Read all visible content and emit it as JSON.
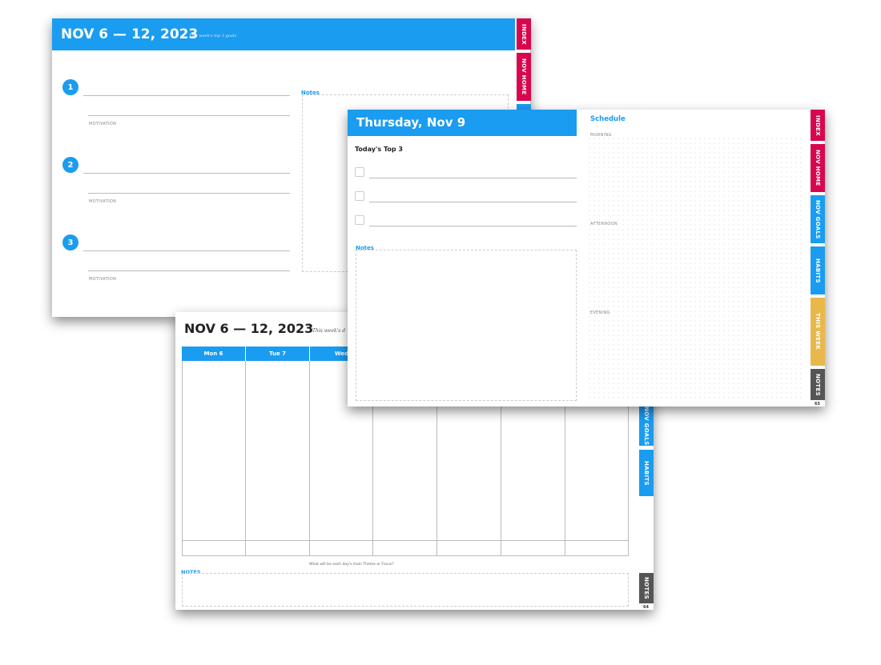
{
  "weekly_goals_page": {
    "title": "NOV 6 — 12, 2023",
    "subtitle": "This week's top 3 goals",
    "goals": [
      {
        "number": "1",
        "label": "MOTIVATION"
      },
      {
        "number": "2",
        "label": "MOTIVATION"
      },
      {
        "number": "3",
        "label": "MOTIVATION"
      }
    ],
    "notes_label": "Notes",
    "tabs": [
      "INDEX",
      "NOV HOME"
    ]
  },
  "weekly_page": {
    "title": "NOV 6 — 12, 2023",
    "subtitle": "This week's d",
    "days": [
      "Mon 6",
      "Tue 7",
      "Wed"
    ],
    "prompt": "What will be each day's main Theme or Focus?",
    "notes_label": "NOTES",
    "tabs": [
      "NOV GOALS",
      "HABITS",
      "NOTES"
    ],
    "page_number": "64"
  },
  "daily_page": {
    "title": "Thursday, Nov 9",
    "top3_label": "Today's Top 3",
    "notes_label": "Notes",
    "schedule_label": "Schedule",
    "morning": "MORNING",
    "afternoon": "AFTERNOON",
    "evening": "EVENING",
    "tabs": [
      "INDEX",
      "NOV HOME",
      "NOV GOALS",
      "HABITS",
      "THIS WEEK",
      "NOTES"
    ],
    "page_number": "65"
  },
  "colors": {
    "accent_blue": "#1a9cf0",
    "tab_pink": "#d7064f",
    "tab_yellow": "#e8b84a",
    "tab_gray": "#555555"
  }
}
